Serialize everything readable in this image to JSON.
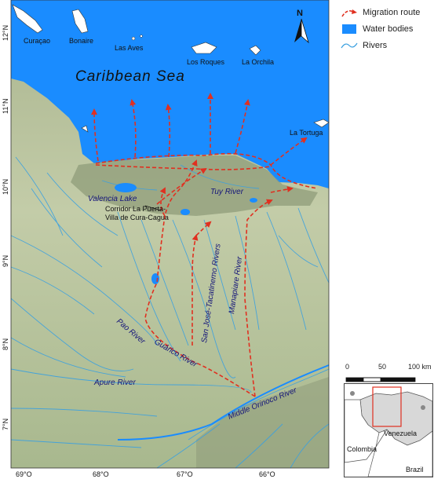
{
  "map": {
    "sea_label": "Caribbean Sea",
    "islands": [
      "Curaçao",
      "Bonaire",
      "Las Aves",
      "Los Roques",
      "La Orchila",
      "La Tortuga"
    ],
    "rivers": [
      "Tuy River",
      "San José-Tacatinemo Rivers",
      "Manapiare River",
      "Pao River",
      "Guárico River",
      "Apure River",
      "Middle Orinoco River"
    ],
    "places": {
      "valencia_lake": "Valencia Lake",
      "corridor": "Corridor La Puerta-\nVilla de Cura-Cagua",
      "corridor_line1": "Corridor La Puerta-",
      "corridor_line2": "Villa de Cura-Cagua"
    },
    "lat_labels": [
      "12°N",
      "11°N",
      "10°N",
      "9°N",
      "8°N",
      "7°N"
    ],
    "lon_labels": [
      "69°O",
      "68°O",
      "67°O",
      "66°O"
    ],
    "north_label": "N"
  },
  "legend": {
    "items": [
      {
        "label": "Migration route",
        "color": "#e03020"
      },
      {
        "label": "Water bodies",
        "color": "#1a8cff"
      },
      {
        "label": "Rivers",
        "color": "#3aa0e0"
      }
    ]
  },
  "scale": {
    "labels": [
      "0",
      "50",
      "100 km"
    ]
  },
  "inset": {
    "countries": [
      "Venezuela",
      "Colombia",
      "Brazil"
    ]
  },
  "colors": {
    "sea": "#1a8cff",
    "route": "#e03020",
    "river": "#3aa0e0",
    "land": "#b8c4a0"
  }
}
